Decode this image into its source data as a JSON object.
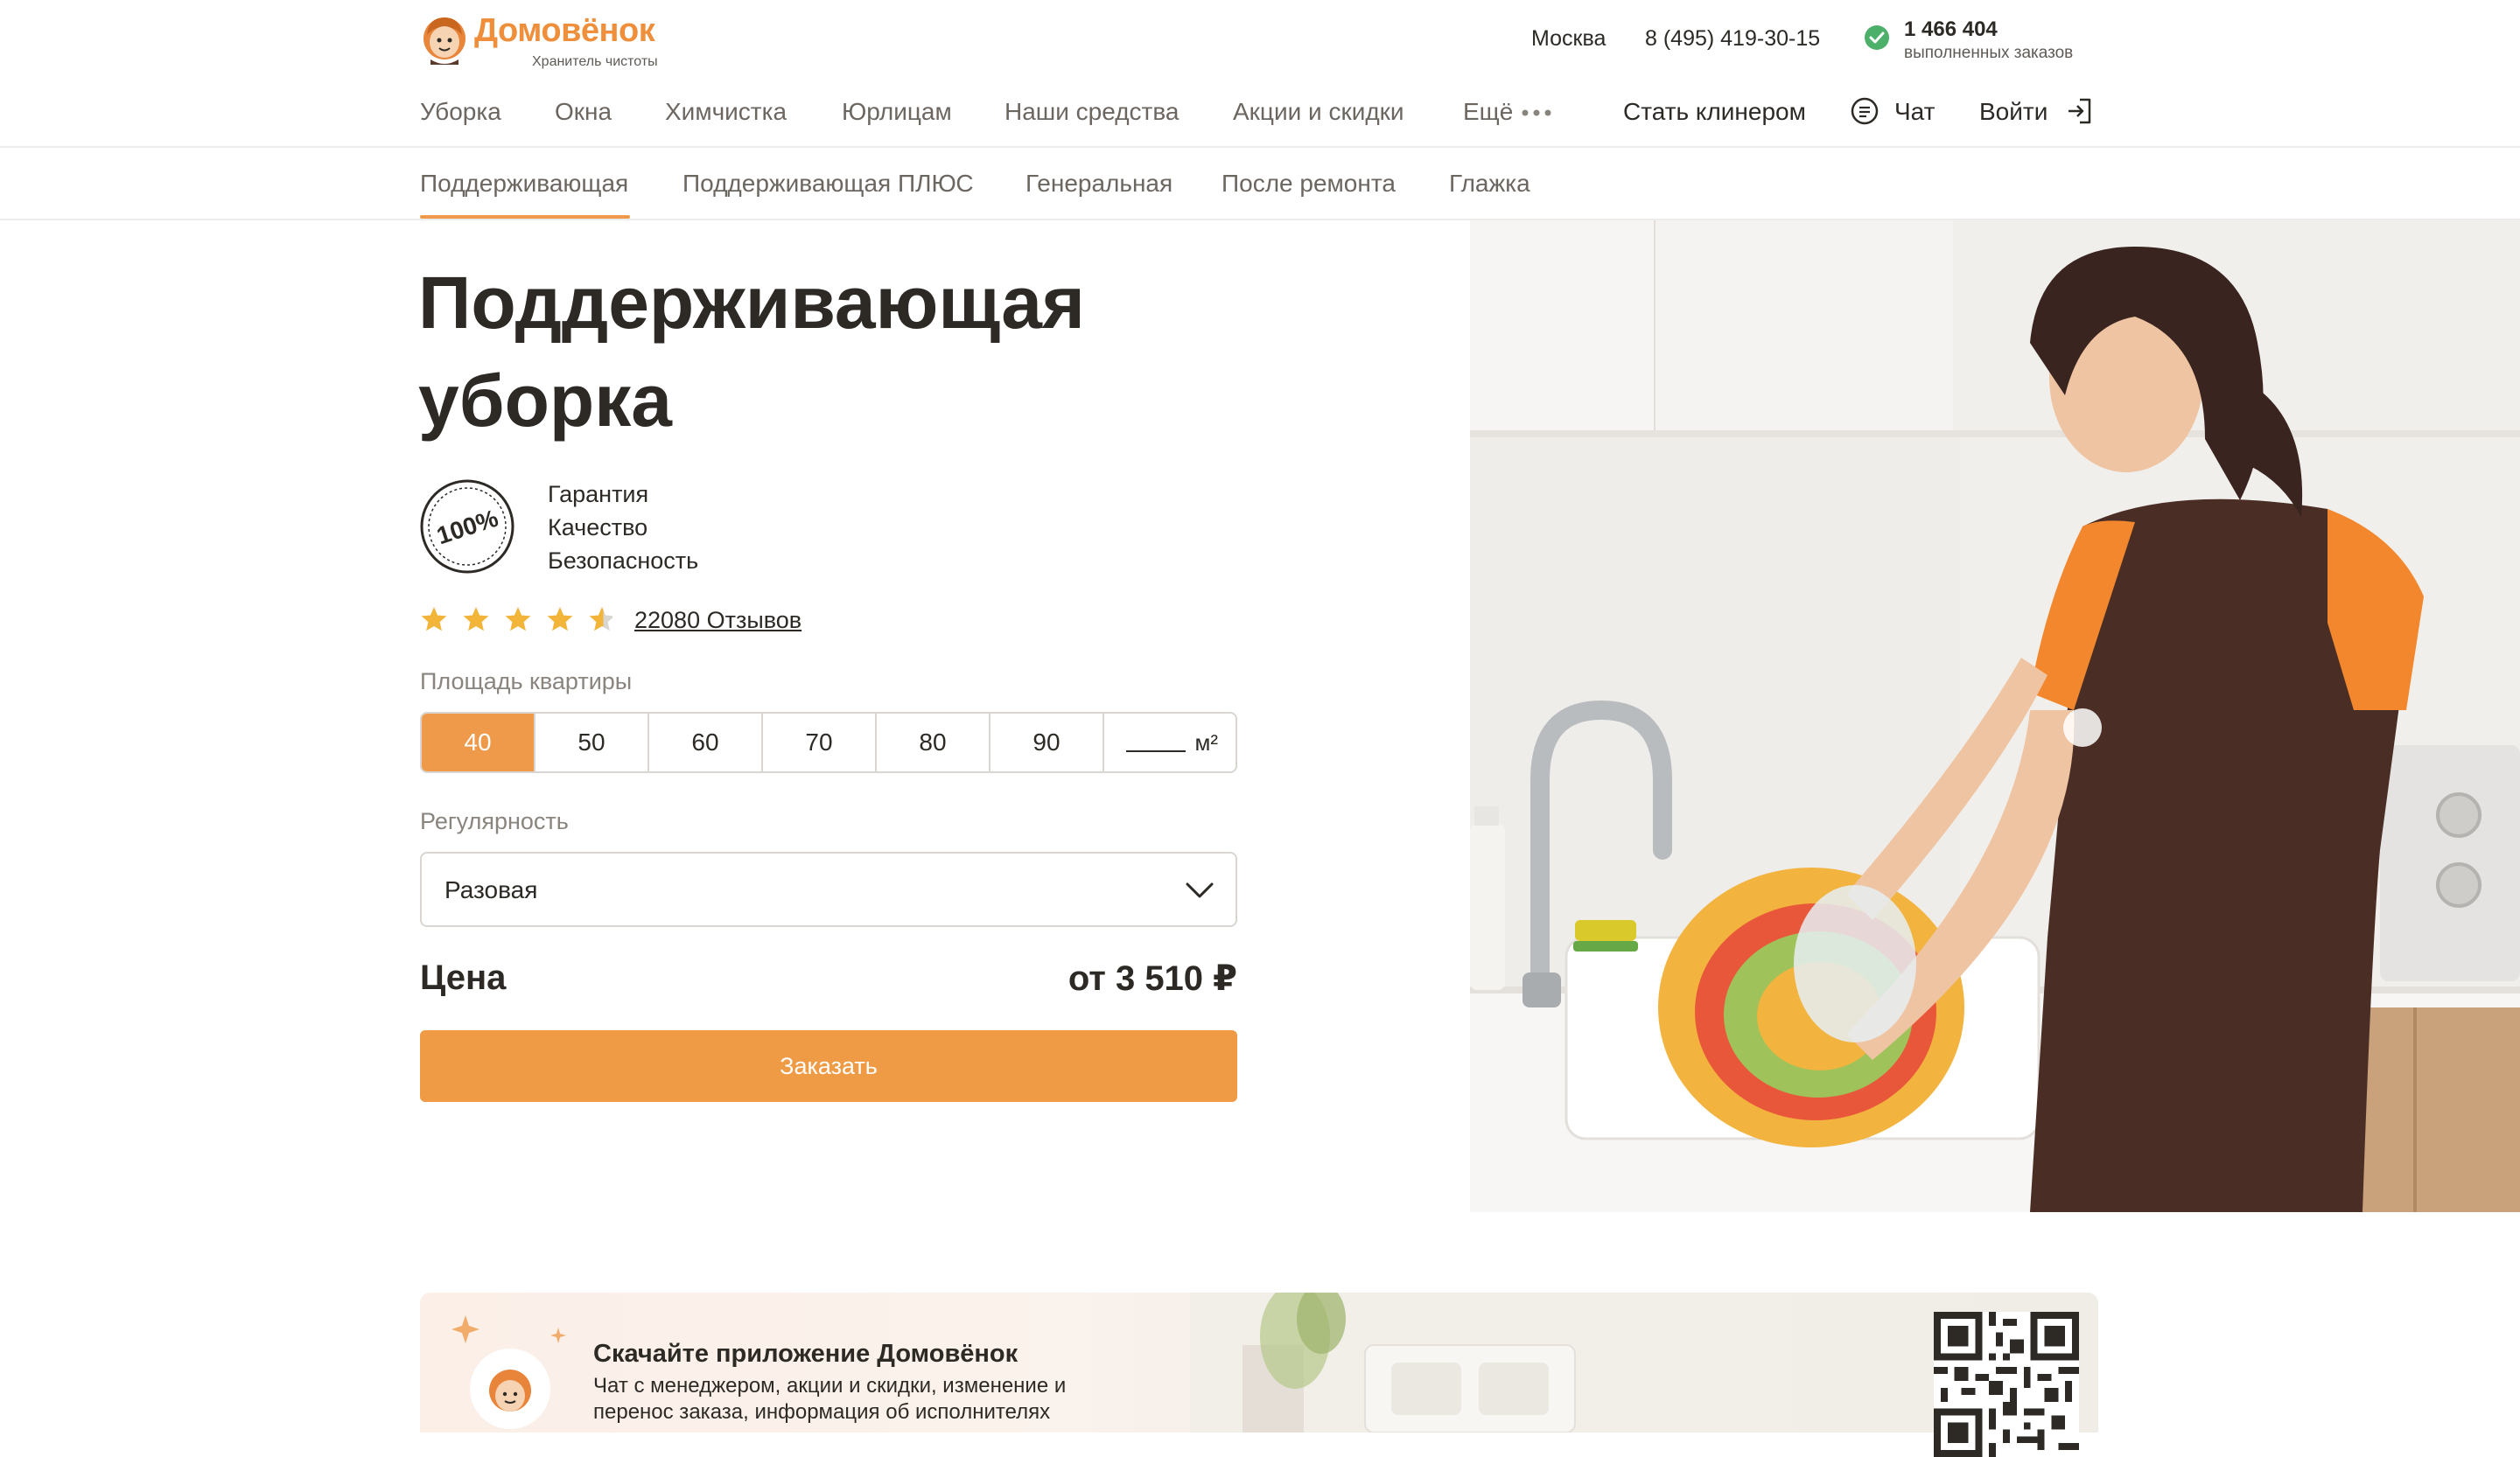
{
  "brand": {
    "name": "Домовёнок",
    "tagline": "Хранитель чистоты",
    "accent_color": "#ef9a4a"
  },
  "topbar": {
    "city": "Москва",
    "phone": "8 (495) 419-30-15",
    "orders_count": "1 466 404",
    "orders_label": "выполненных заказов"
  },
  "main_nav": {
    "items": [
      "Уборка",
      "Окна",
      "Химчистка",
      "Юрлицам",
      "Наши средства",
      "Акции и скидки",
      "Ещё"
    ],
    "become_cleaner": "Стать клинером",
    "chat": "Чат",
    "login": "Войти"
  },
  "sub_nav": {
    "items": [
      "Поддерживающая",
      "Поддерживающая ПЛЮС",
      "Генеральная",
      "После ремонта",
      "Глажка"
    ],
    "active_index": 0
  },
  "service": {
    "title_line1": "Поддерживающая",
    "title_line2": "уборка",
    "badge_text": "100%",
    "features": [
      "Гарантия",
      "Качество",
      "Безопасность"
    ],
    "rating": 4.5,
    "reviews": "22080 Отзывов"
  },
  "calculator": {
    "area_label": "Площадь квартиры",
    "area_options": [
      "40",
      "50",
      "60",
      "70",
      "80",
      "90"
    ],
    "area_selected": "40",
    "area_unit": "м²",
    "regularity_label": "Регулярность",
    "regularity_value": "Разовая",
    "price_label": "Цена",
    "price_value": "от 3 510 ₽",
    "order_button": "Заказать"
  },
  "app_banner": {
    "title": "Скачайте приложение Домовёнок",
    "text": "Чат с менеджером, акции и скидки, изменение и перенос заказа, информация об исполнителях"
  }
}
